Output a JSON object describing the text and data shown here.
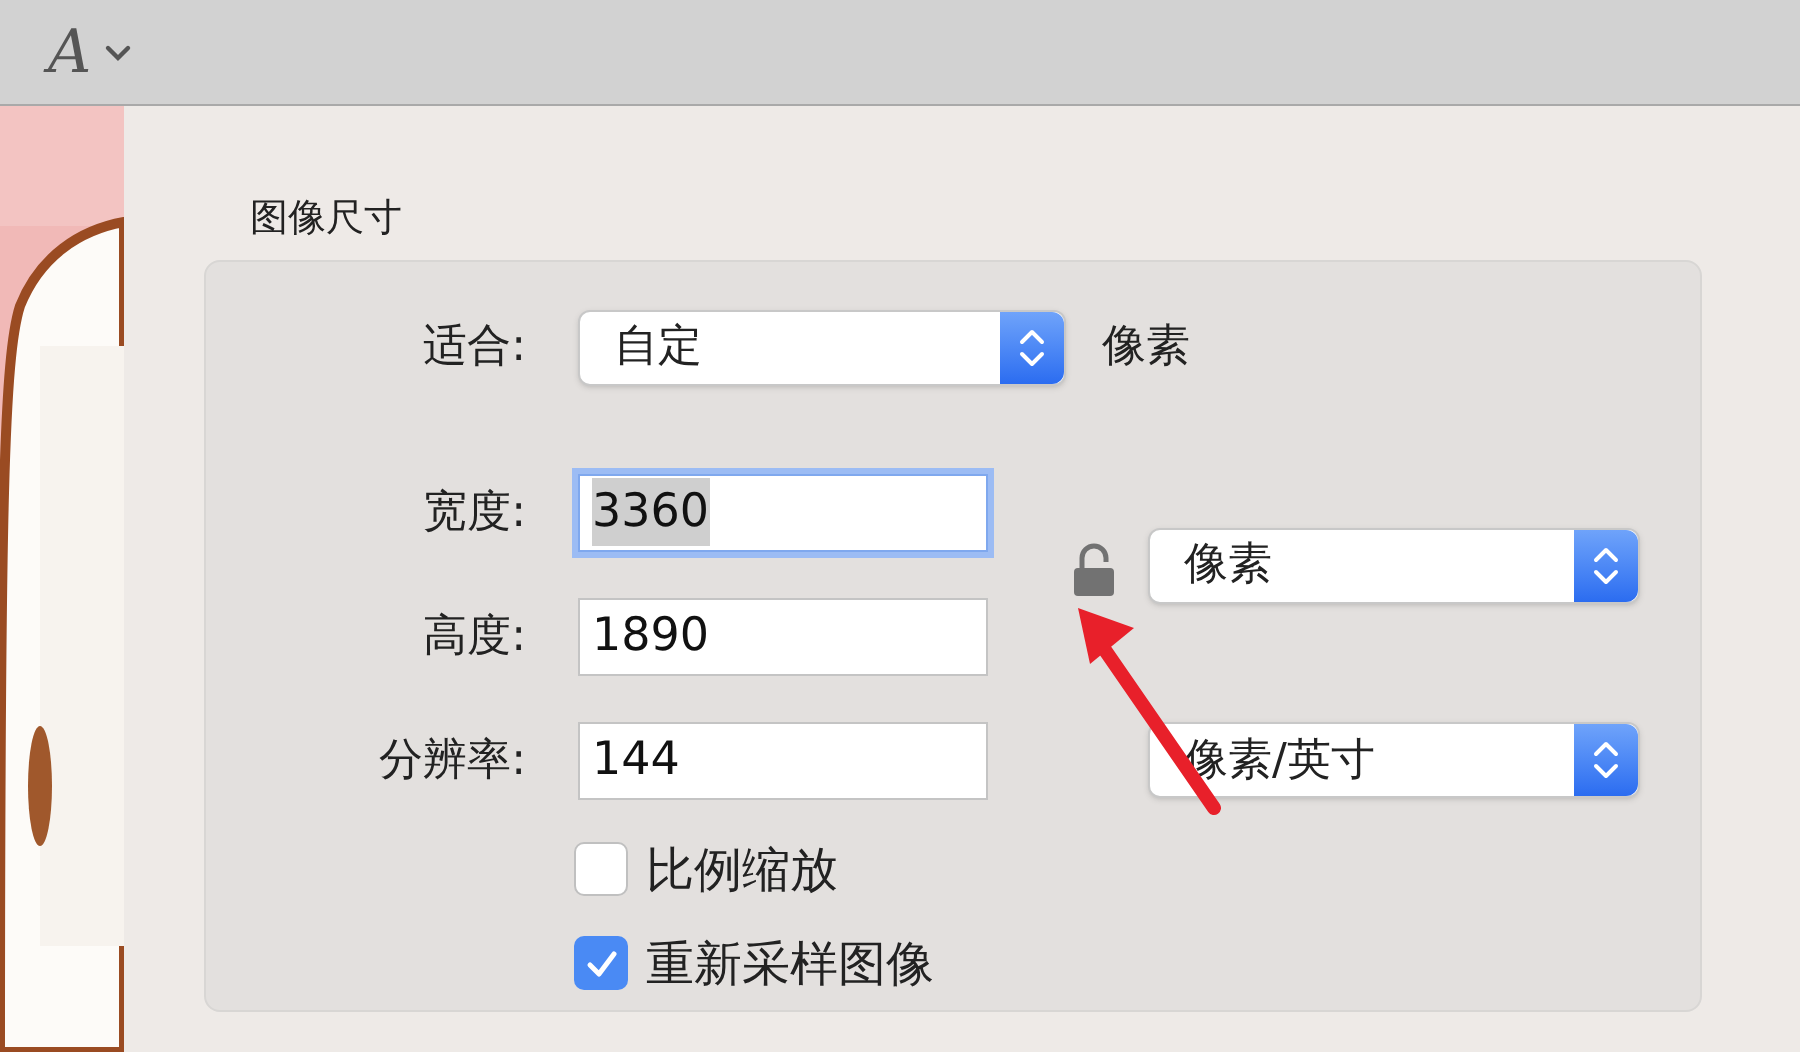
{
  "toolbar": {
    "font_button": "A"
  },
  "dialog": {
    "section_title": "图像尺寸",
    "fit": {
      "label": "适合:",
      "value": "自定",
      "unit": "像素"
    },
    "fields": [
      {
        "label": "宽度:",
        "value": "3360",
        "focused": true
      },
      {
        "label": "高度:",
        "value": "1890",
        "focused": false
      },
      {
        "label": "分辨率:",
        "value": "144",
        "focused": false
      }
    ],
    "lock": {
      "locked": false
    },
    "size_unit": "像素",
    "resolution_unit": "像素/英寸",
    "checkboxes": [
      {
        "label": "比例缩放",
        "checked": false
      },
      {
        "label": "重新采样图像",
        "checked": true
      }
    ]
  }
}
